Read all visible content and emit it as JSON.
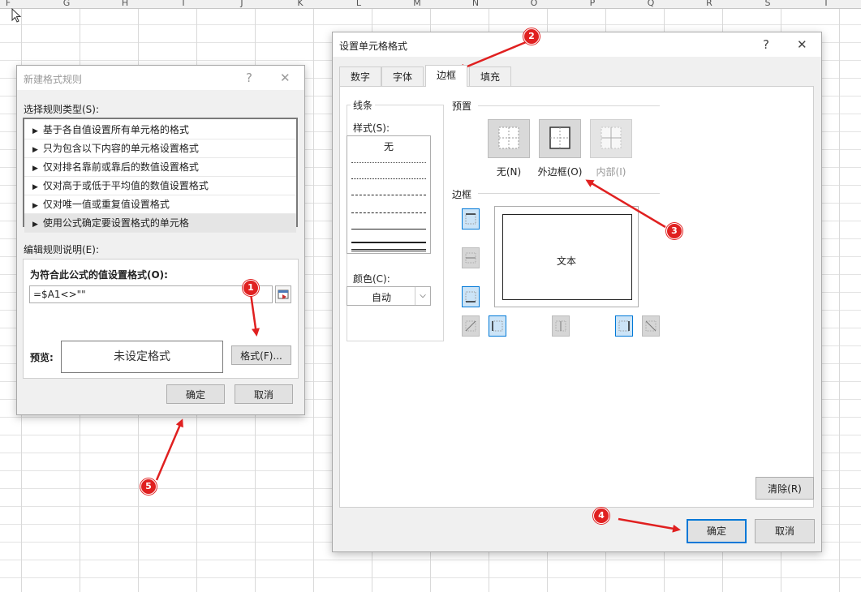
{
  "spreadsheet": {
    "columns": [
      "F",
      "G",
      "H",
      "I",
      "J",
      "K",
      "L",
      "M",
      "N",
      "O",
      "P",
      "Q",
      "R",
      "S",
      "T"
    ]
  },
  "new_rule_dialog": {
    "title": "新建格式规则",
    "help": "?",
    "close": "✕",
    "select_type_label": "选择规则类型(S):",
    "rule_types": [
      "基于各自值设置所有单元格的格式",
      "只为包含以下内容的单元格设置格式",
      "仅对排名靠前或靠后的数值设置格式",
      "仅对高于或低于平均值的数值设置格式",
      "仅对唯一值或重复值设置格式",
      "使用公式确定要设置格式的单元格"
    ],
    "edit_desc_label": "编辑规则说明(E):",
    "formula_label": "为符合此公式的值设置格式(O):",
    "formula_value": "=$A1<>\"\"",
    "preview_label": "预览:",
    "preview_text": "未设定格式",
    "format_button": "格式(F)...",
    "ok": "确定",
    "cancel": "取消"
  },
  "format_cells_dialog": {
    "title": "设置单元格格式",
    "help": "?",
    "close": "✕",
    "tabs": [
      "数字",
      "字体",
      "边框",
      "填充"
    ],
    "active_tab": "边框",
    "line_group": "线条",
    "style_label": "样式(S):",
    "style_none": "无",
    "color_label": "颜色(C):",
    "color_value": "自动",
    "presets_group": "预置",
    "presets": [
      "无(N)",
      "外边框(O)",
      "内部(I)"
    ],
    "border_group": "边框",
    "preview_text": "文本",
    "clear_button": "清除(R)",
    "ok": "确定",
    "cancel": "取消"
  },
  "annotations": [
    "1",
    "2",
    "3",
    "4",
    "5"
  ],
  "colors": {
    "accent": "#0078d7",
    "annotation": "#e02020"
  }
}
